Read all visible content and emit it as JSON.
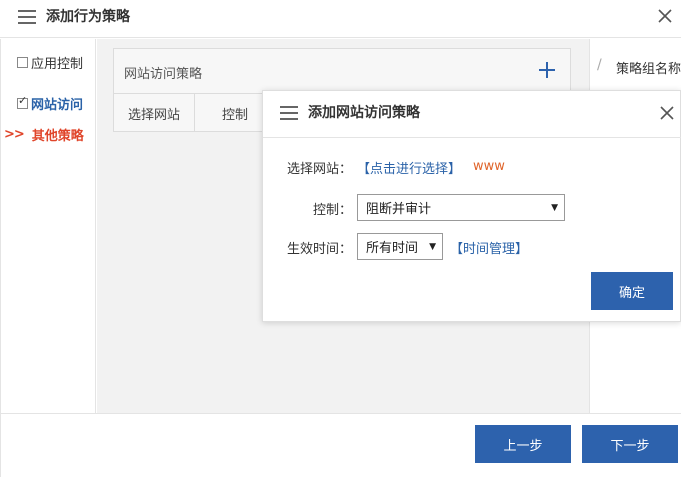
{
  "outer": {
    "title": "添加行为策略",
    "menu_icon": "menu-icon",
    "close_icon": "close-icon"
  },
  "left_nav": {
    "items": [
      {
        "label": "应用控制",
        "checked": false
      },
      {
        "label": "网站访问",
        "checked": true
      },
      {
        "label": "其他策略",
        "marker": ">>"
      }
    ]
  },
  "web_panel": {
    "title": "网站访问策略",
    "add_icon": "plus-icon",
    "columns": [
      "选择网站",
      "控制"
    ]
  },
  "right_panel": {
    "label": "策略组名称"
  },
  "footer": {
    "prev_label": "上一步",
    "next_label": "下一步"
  },
  "modal": {
    "title": "添加网站访问策略",
    "site_label": "选择网站：",
    "site_link": "【点击进行选择】",
    "site_value": "www",
    "control_label": "控制：",
    "control_value": "阻断并审计",
    "time_label": "生效时间：",
    "time_value": "所有时间",
    "time_link": "【时间管理】",
    "ok_label": "确定"
  },
  "colors": {
    "primary": "#2d62ad",
    "link": "#2a62a8",
    "accent": "#e0452a"
  }
}
